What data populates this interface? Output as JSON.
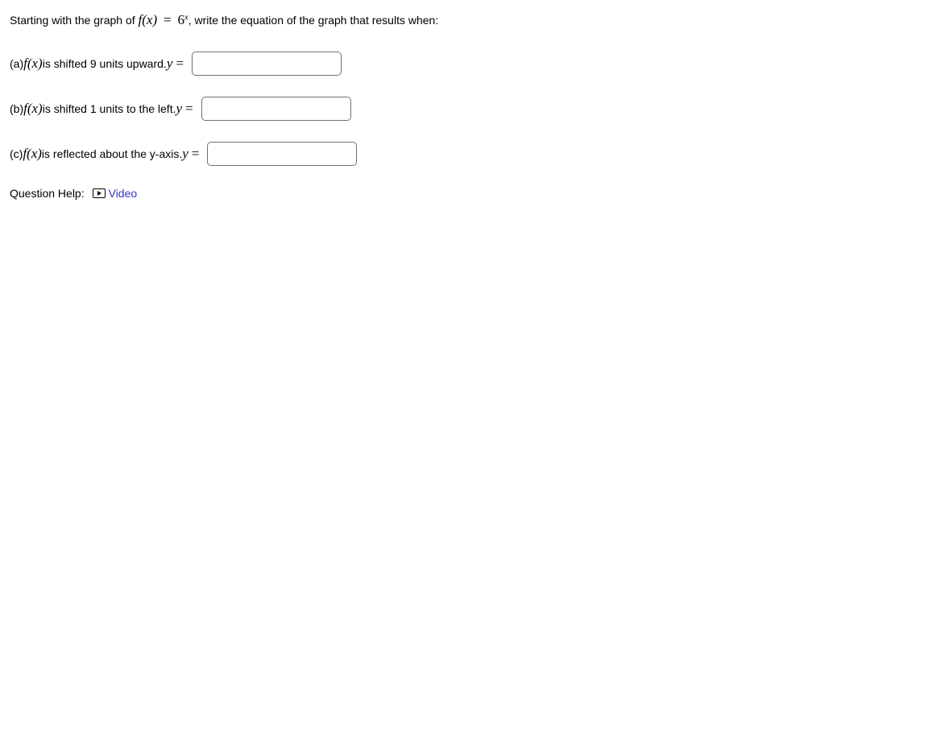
{
  "intro": {
    "pre": "Starting with the graph of ",
    "fx": "f(x)",
    "eq": "=",
    "base": "6",
    "exp": "x",
    "post": ", write the equation of the graph that results when:"
  },
  "parts": {
    "a": {
      "label_pre": "(a) ",
      "fx": "f(x)",
      "desc": " is shifted 9 units upward. ",
      "y": "y",
      "eq": "="
    },
    "b": {
      "label_pre": "(b) ",
      "fx": "f(x)",
      "desc": " is shifted 1 units to the left. ",
      "y": "y",
      "eq": "="
    },
    "c": {
      "label_pre": "(c) ",
      "fx": "f(x)",
      "desc": " is reflected about the y-axis. ",
      "y": "y",
      "eq": "="
    }
  },
  "help": {
    "label": "Question Help:",
    "video": "Video"
  }
}
